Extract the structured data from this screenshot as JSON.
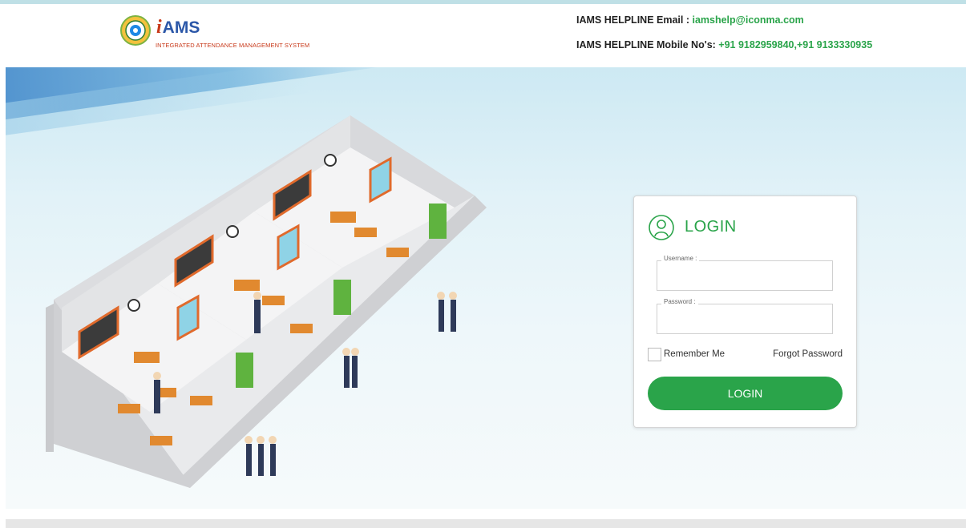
{
  "header": {
    "brand_prefix": "i",
    "brand_name": "AMS",
    "tagline": "INTEGRATED ATTENDANCE MANAGEMENT SYSTEM",
    "helpline_email_label": "IAMS HELPLINE Email : ",
    "helpline_email": "iamshelp@iconma.com",
    "helpline_mobile_label": "IAMS HELPLINE Mobile No's: ",
    "helpline_mobile": "+91 9182959840,+91 9133330935"
  },
  "login": {
    "title": "LOGIN",
    "username_label": "Username :",
    "username_value": "",
    "password_label": "Password :",
    "password_value": "",
    "remember_label": "Remember Me",
    "remember_checked": false,
    "forgot_label": "Forgot Password",
    "button_label": "LOGIN",
    "user_icon": "user-circle-icon"
  },
  "colors": {
    "accent_green": "#2aa44a",
    "brand_blue": "#2b57a8",
    "brand_red": "#c8391a"
  }
}
